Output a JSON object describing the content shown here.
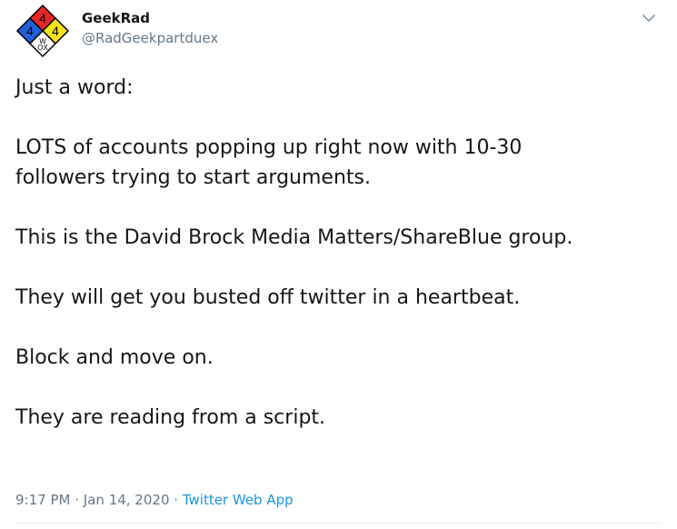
{
  "author": {
    "display_name": "GeekRad",
    "handle": "@RadGeekpartduex",
    "avatar": {
      "icon": "nfpa-diamond-icon",
      "top_number": "4",
      "left_number": "4",
      "right_number": "4",
      "bottom_text": "W OX",
      "colors": {
        "top": "#e8262a",
        "left": "#1f5fd6",
        "right": "#f5e31b",
        "bottom": "#ffffff"
      }
    }
  },
  "menu": {
    "icon": "chevron-down-icon"
  },
  "tweet": {
    "line1": "Just a word:",
    "line2a": "LOTS of accounts popping up right now with 10-30",
    "line2b": "followers trying to start arguments.",
    "line3": "This is the David Brock Media Matters/ShareBlue group.",
    "line4": "They will get you busted off twitter in a heartbeat.",
    "line5": "Block and move on.",
    "line6": "They are reading from a script."
  },
  "meta": {
    "time": "9:17 PM",
    "separator": "·",
    "date": "Jan 14, 2020",
    "source": "Twitter Web App"
  },
  "colors": {
    "text": "#14171a",
    "secondary": "#657786",
    "link": "#1b95e0",
    "divider": "#e6ecf0"
  }
}
